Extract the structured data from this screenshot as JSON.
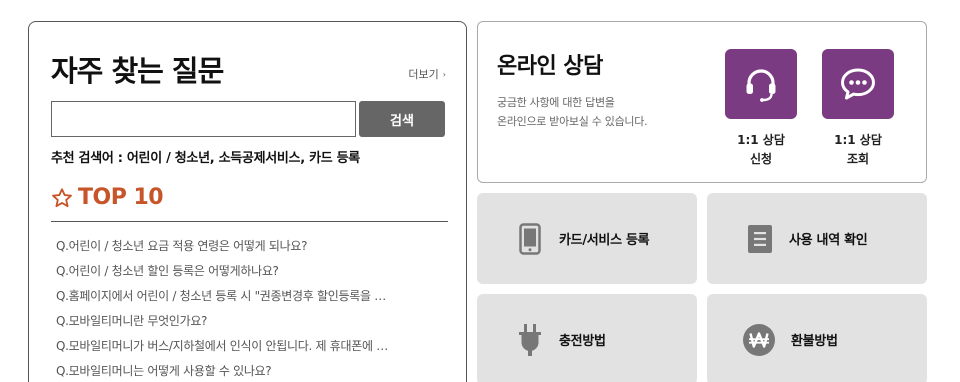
{
  "faq": {
    "title": "자주 찾는 질문",
    "more_label": "더보기",
    "search": {
      "placeholder": "",
      "button_label": "검색"
    },
    "recommend_text": "추천 검색어 : 어린이 / 청소년, 소득공제서비스, 카드 등록",
    "top_label": "TOP 10",
    "items": [
      "Q.어린이 / 청소년 요금 적용 연령은 어떻게 되나요?",
      "Q.어린이 / 청소년 할인 등록은 어떻게하나요?",
      "Q.홈페이지에서 어린이 / 청소년 등록 시 \"권종변경후 할인등록을 …",
      "Q.모바일티머니란 무엇인가요?",
      "Q.모바일티머니가 버스/지하철에서 인식이 안됩니다. 제 휴대폰에 …",
      "Q.모바일티머니는 어떻게 사용할 수 있나요?"
    ]
  },
  "consult": {
    "title": "온라인 상담",
    "desc_line1": "궁금한 사항에 대한 답변을",
    "desc_line2": "온라인으로 받아보실 수 있습니다.",
    "apply": {
      "line1": "1:1 상담",
      "line2": "신청",
      "icon": "headset-icon"
    },
    "inquiry": {
      "line1": "1:1 상담",
      "line2": "조회",
      "icon": "chat-bubble-icon"
    }
  },
  "services": {
    "card": {
      "label": "카드/서비스 등록",
      "icon": "phone-icon"
    },
    "usage": {
      "label": "사용 내역 확인",
      "icon": "document-icon"
    },
    "charge": {
      "label": "충전방법",
      "icon": "plug-icon"
    },
    "refund": {
      "label": "환불방법",
      "icon": "won-icon"
    }
  },
  "colors": {
    "accent_purple": "#7a3b82",
    "top10_orange": "#c7552a",
    "search_button": "#666666",
    "tile_bg": "#e2e2e2"
  }
}
